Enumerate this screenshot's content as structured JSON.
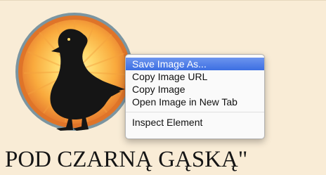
{
  "page": {
    "heading": "POD CZARNĄ GĄSKĄ\""
  },
  "logo": {
    "icon": "black-goose-sun-logo",
    "colors": {
      "outer_ring": "#7b95a1",
      "orange_ring": "#e5782b",
      "sun_center": "#ffd86b",
      "goose": "#151515"
    }
  },
  "context_menu": {
    "items": [
      {
        "label": "Save Image As...",
        "active": true
      },
      {
        "label": "Copy Image URL",
        "active": false
      },
      {
        "label": "Copy Image",
        "active": false
      },
      {
        "label": "Open Image in New Tab",
        "active": false
      }
    ],
    "secondary_items": [
      {
        "label": "Inspect Element",
        "active": false
      }
    ],
    "highlight_color": "#3c6fe2"
  }
}
